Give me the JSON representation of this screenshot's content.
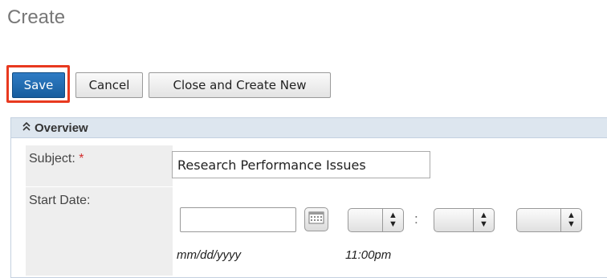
{
  "page": {
    "title": "Create"
  },
  "toolbar": {
    "save_label": "Save",
    "cancel_label": "Cancel",
    "close_create_new_label": "Close and Create New",
    "highlight_color": "#e8391f"
  },
  "panel": {
    "title": "Overview",
    "collapse_icon": "double-chevron-up-icon"
  },
  "form": {
    "subject": {
      "label": "Subject:",
      "required_marker": "*",
      "value": "Research Performance Issues"
    },
    "start_date": {
      "label": "Start Date:",
      "date_value": "",
      "date_format_hint": "mm/dd/yyyy",
      "time_hint": "11:00pm",
      "time_separator": ":",
      "calendar_icon": "calendar-icon"
    }
  },
  "colors": {
    "primary_button": "#1f6db3",
    "panel_header": "#dde6ef",
    "required": "#d32f2f"
  }
}
